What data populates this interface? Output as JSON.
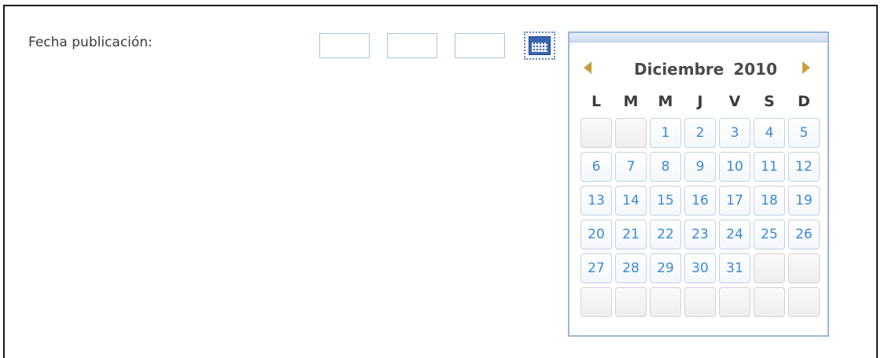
{
  "form": {
    "field_label": "Fecha publicación:",
    "day_value": "",
    "month_value": "",
    "year_value": ""
  },
  "calendar_trigger": {
    "icon": "calendar-icon"
  },
  "calendar": {
    "month": "Diciembre",
    "year": "2010",
    "prev_icon": "arrow-left-icon",
    "next_icon": "arrow-right-icon",
    "weekdays": [
      "L",
      "M",
      "M",
      "J",
      "V",
      "S",
      "D"
    ],
    "weeks": [
      [
        "",
        "",
        "1",
        "2",
        "3",
        "4",
        "5"
      ],
      [
        "6",
        "7",
        "8",
        "9",
        "10",
        "11",
        "12"
      ],
      [
        "13",
        "14",
        "15",
        "16",
        "17",
        "18",
        "19"
      ],
      [
        "20",
        "21",
        "22",
        "23",
        "24",
        "25",
        "26"
      ],
      [
        "27",
        "28",
        "29",
        "30",
        "31",
        "",
        ""
      ],
      [
        "",
        "",
        "",
        "",
        "",
        "",
        ""
      ]
    ]
  },
  "colors": {
    "day_text": "#3a8ad8",
    "cell_border": "#c4d2e4",
    "calendar_border": "#9ab7dd",
    "nav_arrow": "#c8a040"
  }
}
